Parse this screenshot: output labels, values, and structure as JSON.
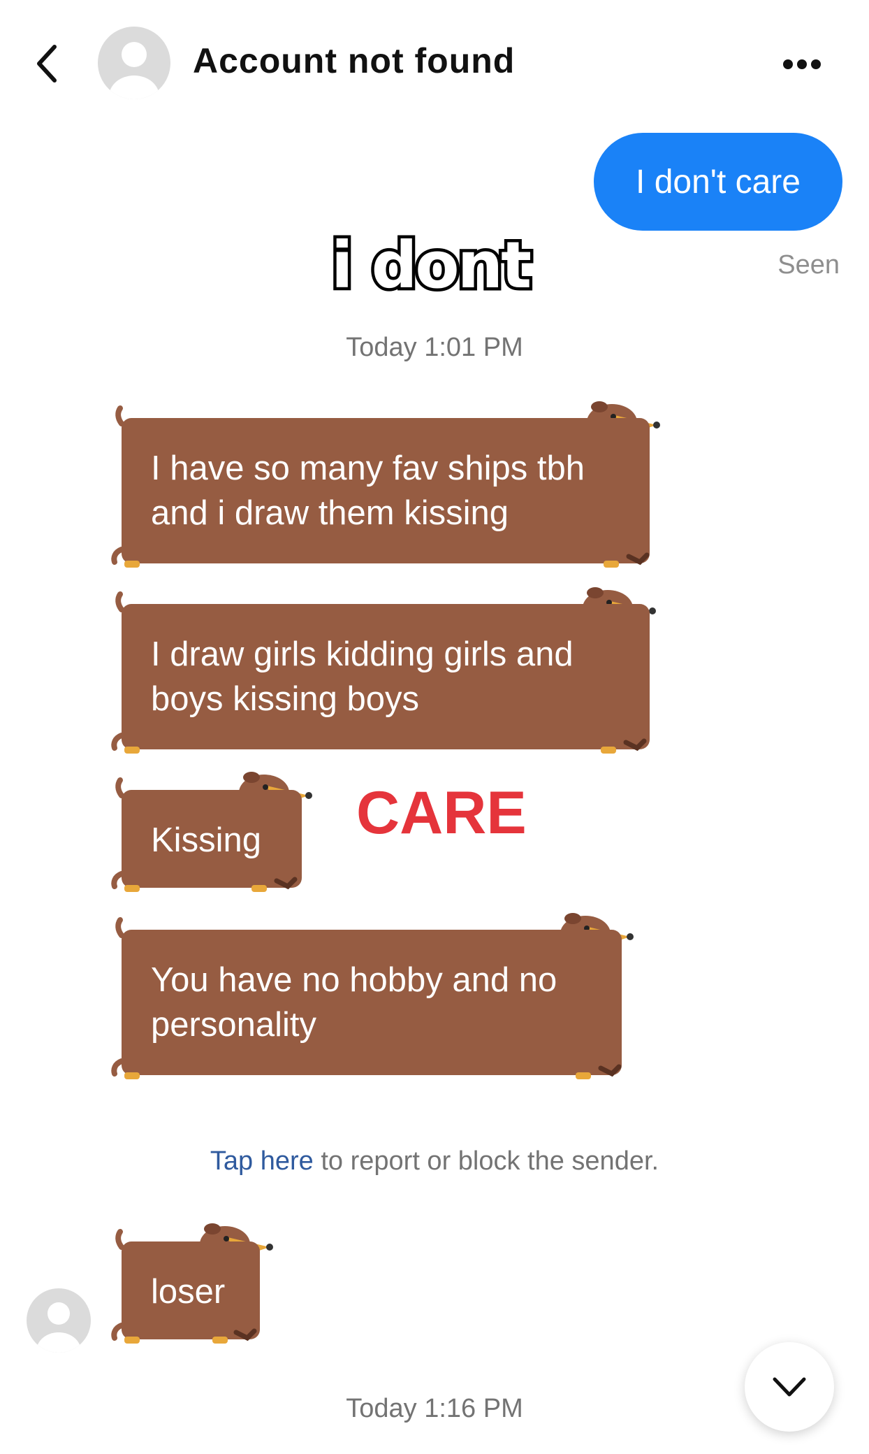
{
  "header": {
    "title": "Account not found"
  },
  "sent": {
    "text": "I don't care",
    "status": "Seen"
  },
  "overlays": {
    "top": "i dont",
    "middle": "CARE"
  },
  "timestamps": {
    "first": "Today 1:01 PM",
    "second": "Today 1:16 PM"
  },
  "received": [
    {
      "line1": "I have so many fav ships tbh",
      "line2": "and i draw them kissing"
    },
    {
      "line1": "I draw girls kidding girls and",
      "line2": "boys kissing boys"
    },
    {
      "line1": "Kissing"
    },
    {
      "line1": "You have no hobby and no",
      "line2": "personality"
    },
    {
      "line1": "loser"
    }
  ],
  "report": {
    "link": "Tap here",
    "rest": " to report or block the sender."
  },
  "colors": {
    "sent_bubble": "#1a82f7",
    "dog_bubble": "#965c42",
    "care_text": "#e5343b",
    "link": "#2f5a9e"
  },
  "icons": {
    "back": "chevron-left-icon",
    "more": "more-horizontal-icon",
    "scroll": "chevron-down-icon"
  }
}
